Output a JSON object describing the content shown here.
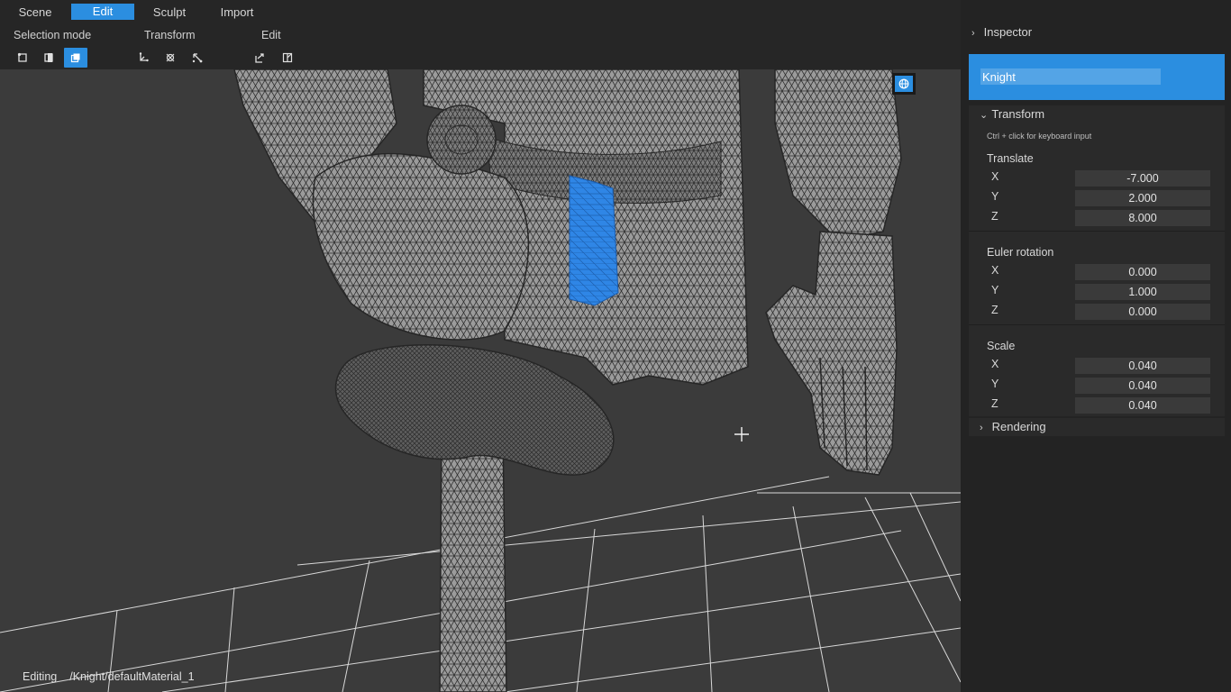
{
  "menu": {
    "items": [
      {
        "label": "Scene",
        "active": false
      },
      {
        "label": "Edit",
        "active": true
      },
      {
        "label": "Sculpt",
        "active": false
      },
      {
        "label": "Import",
        "active": false
      }
    ]
  },
  "toolbar": {
    "selection_mode_label": "Selection mode",
    "transform_label": "Transform",
    "edit_label": "Edit",
    "selection_buttons": [
      {
        "icon": "vertex-select-icon",
        "active": false
      },
      {
        "icon": "edge-select-icon",
        "active": false
      },
      {
        "icon": "face-select-icon",
        "active": true
      }
    ],
    "transform_buttons": [
      {
        "icon": "translate-icon"
      },
      {
        "icon": "rotate-icon"
      },
      {
        "icon": "scale-icon"
      }
    ],
    "edit_buttons": [
      {
        "icon": "extrude-icon"
      },
      {
        "icon": "inset-icon"
      }
    ]
  },
  "viewport": {
    "gizmo_icon": "globe-icon",
    "accent": "#2b8ee0",
    "mesh_color": "#9a9a9a",
    "selection_color": "#2f86e6"
  },
  "status": {
    "mode": "Editing",
    "path": "/Knight/defaultMaterial_1"
  },
  "inspector": {
    "title": "Inspector",
    "object_name": "Knight",
    "transform": {
      "title": "Transform",
      "hint": "Ctrl + click for keyboard input",
      "translate": {
        "title": "Translate",
        "x": "-7.000",
        "y": "2.000",
        "z": "8.000"
      },
      "rotation": {
        "title": "Euler rotation",
        "x": "0.000",
        "y": "1.000",
        "z": "0.000"
      },
      "scale": {
        "title": "Scale",
        "x": "0.040",
        "y": "0.040",
        "z": "0.040"
      },
      "axis_labels": {
        "x": "X",
        "y": "Y",
        "z": "Z"
      }
    },
    "rendering_title": "Rendering"
  }
}
